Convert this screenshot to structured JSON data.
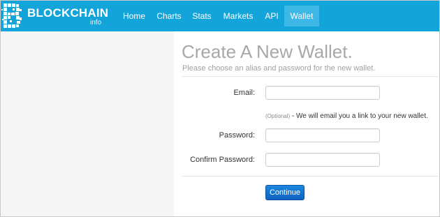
{
  "colors": {
    "header_bg": "#13a5d9",
    "header_active": "#3db8e6",
    "button_bg": "#1b87e0",
    "left_panel_bg": "#f5f5f5"
  },
  "brand": {
    "name": "BLOCKCHAIN",
    "sub": "info",
    "icon": "blockchain-b-logo-icon"
  },
  "nav": {
    "items": [
      {
        "label": "Home"
      },
      {
        "label": "Charts"
      },
      {
        "label": "Stats"
      },
      {
        "label": "Markets"
      },
      {
        "label": "API"
      },
      {
        "label": "Wallet",
        "active": true
      }
    ]
  },
  "main": {
    "title": "Create A New Wallet.",
    "subtitle": "Please choose an alias and password for the new wallet.",
    "fields": {
      "email": {
        "label": "Email:",
        "value": "",
        "placeholder": ""
      },
      "password": {
        "label": "Password:",
        "value": "",
        "placeholder": ""
      },
      "confirm_password": {
        "label": "Confirm Password:",
        "value": "",
        "placeholder": ""
      }
    },
    "email_help": {
      "optional": "(Optional)",
      "message": " - We will email you a link to your new wallet."
    },
    "continue_label": "Continue"
  }
}
